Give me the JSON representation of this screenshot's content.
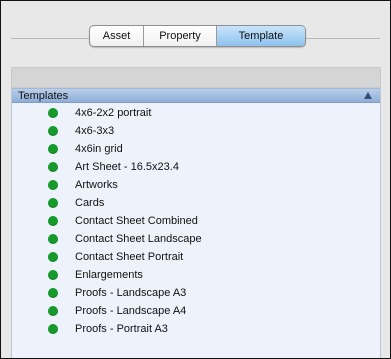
{
  "tabs": [
    {
      "label": "Asset"
    },
    {
      "label": "Property"
    },
    {
      "label": "Template",
      "selected": true
    }
  ],
  "list": {
    "header": "Templates",
    "sort_icon": "triangle-up-icon",
    "status_color": "#159a2b",
    "items": [
      {
        "label": "4x6-2x2 portrait"
      },
      {
        "label": "4x6-3x3"
      },
      {
        "label": "4x6in grid"
      },
      {
        "label": "Art Sheet - 16.5x23.4"
      },
      {
        "label": "Artworks"
      },
      {
        "label": "Cards"
      },
      {
        "label": "Contact Sheet Combined"
      },
      {
        "label": "Contact Sheet Landscape"
      },
      {
        "label": "Contact Sheet Portrait"
      },
      {
        "label": "Enlargements"
      },
      {
        "label": "Proofs - Landscape A3"
      },
      {
        "label": "Proofs - Landscape A4"
      },
      {
        "label": "Proofs - Portrait A3"
      }
    ]
  }
}
